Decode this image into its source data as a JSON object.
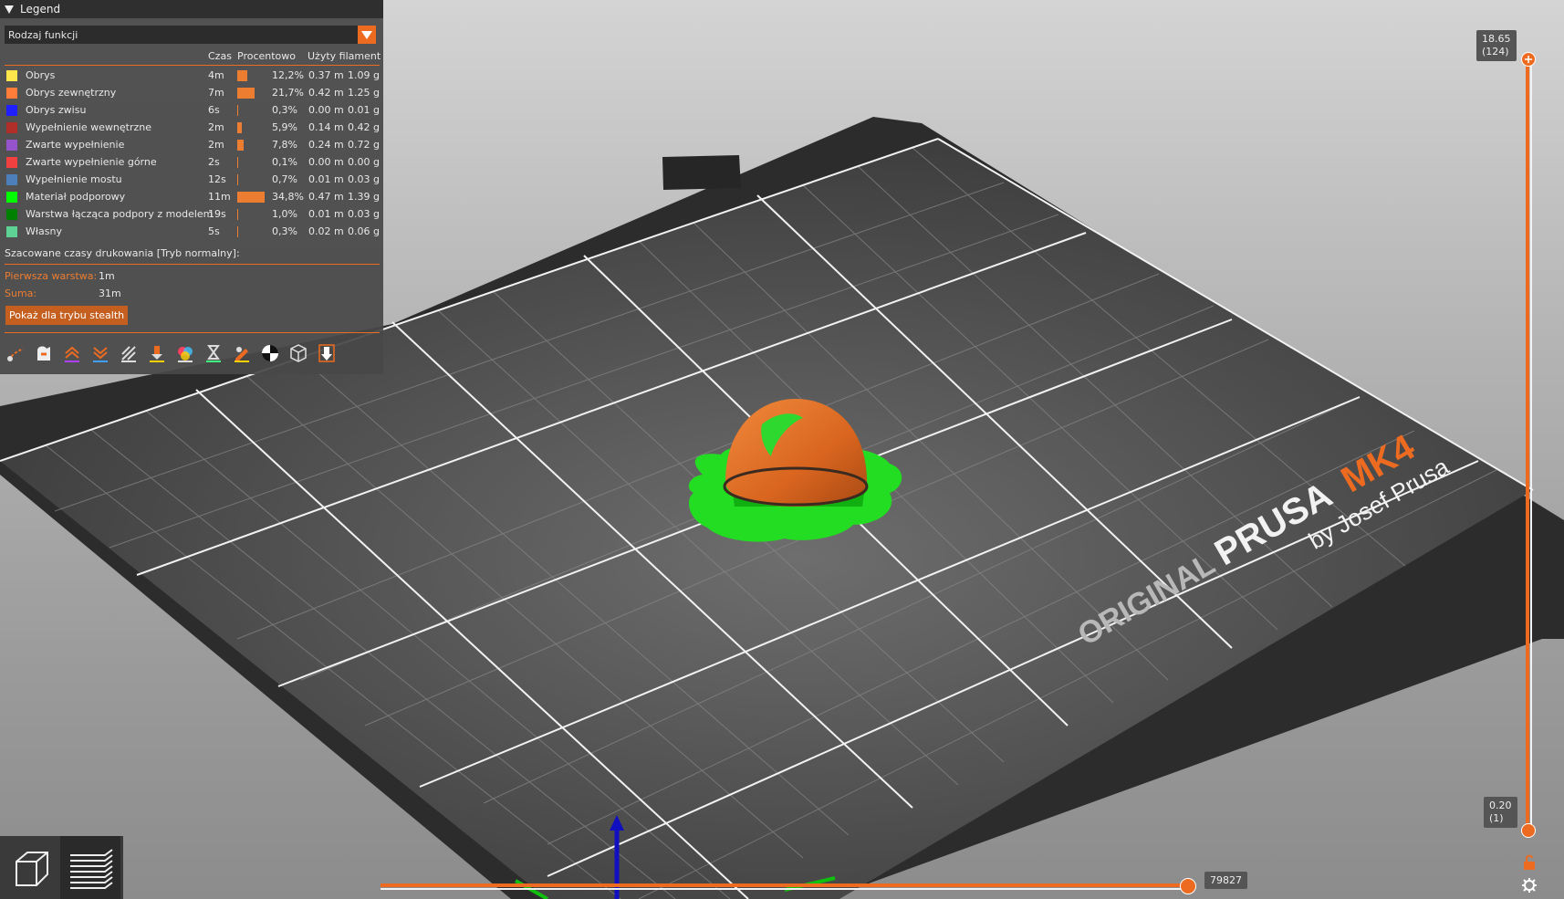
{
  "legend": {
    "title": "Legend",
    "view_type": "Rodzaj funkcji",
    "columns": {
      "time": "Czas",
      "percent": "Procentowo",
      "filament": "Użyty filament"
    },
    "rows": [
      {
        "color": "#FFE64D",
        "name": "Obrys",
        "time": "4m",
        "percent": "12,2%",
        "percent_value": 12.2,
        "length": "0.37 m",
        "weight": "1.09 g"
      },
      {
        "color": "#FF7D38",
        "name": "Obrys zewnętrzny",
        "time": "7m",
        "percent": "21,7%",
        "percent_value": 21.7,
        "length": "0.42 m",
        "weight": "1.25 g"
      },
      {
        "color": "#1F1FFF",
        "name": "Obrys zwisu",
        "time": "6s",
        "percent": "0,3%",
        "percent_value": 0.3,
        "length": "0.00 m",
        "weight": "0.01 g"
      },
      {
        "color": "#B03029",
        "name": "Wypełnienie wewnętrzne",
        "time": "2m",
        "percent": "5,9%",
        "percent_value": 5.9,
        "length": "0.14 m",
        "weight": "0.42 g"
      },
      {
        "color": "#9654CC",
        "name": "Zwarte wypełnienie",
        "time": "2m",
        "percent": "7,8%",
        "percent_value": 7.8,
        "length": "0.24 m",
        "weight": "0.72 g"
      },
      {
        "color": "#F04040",
        "name": "Zwarte wypełnienie górne",
        "time": "2s",
        "percent": "0,1%",
        "percent_value": 0.1,
        "length": "0.00 m",
        "weight": "0.00 g"
      },
      {
        "color": "#4D80BA",
        "name": "Wypełnienie mostu",
        "time": "12s",
        "percent": "0,7%",
        "percent_value": 0.7,
        "length": "0.01 m",
        "weight": "0.03 g"
      },
      {
        "color": "#00FF00",
        "name": "Materiał podporowy",
        "time": "11m",
        "percent": "34,8%",
        "percent_value": 34.8,
        "length": "0.47 m",
        "weight": "1.39 g"
      },
      {
        "color": "#008000",
        "name": "Warstwa łącząca podpory z modelem",
        "time": "19s",
        "percent": "1,0%",
        "percent_value": 1.0,
        "length": "0.01 m",
        "weight": "0.03 g"
      },
      {
        "color": "#5ED194",
        "name": "Własny",
        "time": "5s",
        "percent": "0,3%",
        "percent_value": 0.3,
        "length": "0.02 m",
        "weight": "0.06 g"
      }
    ],
    "estimated_title": "Szacowane czasy drukowania [Tryb normalny]:",
    "first_layer_label": "Pierwsza warstwa:",
    "first_layer_value": "1m",
    "total_label": "Suma:",
    "total_value": "31m",
    "stealth_button": "Pokaż dla trybu stealth"
  },
  "toolbar_icons": [
    "travel-icon",
    "wipe-icon",
    "retractions-icon",
    "deretractions-icon",
    "seams-icon",
    "tool-changes-icon",
    "color-changes-icon",
    "pause-prints-icon",
    "custom-gcodes-icon",
    "center-of-gravity-icon",
    "shells-icon",
    "tool-marker-icon"
  ],
  "vertical_slider": {
    "top_height": "18.65",
    "top_layer": "(124)",
    "bottom_height": "0.20",
    "bottom_layer": "(1)",
    "top_fraction": 1.0,
    "bottom_fraction": 0.0
  },
  "horizontal_slider": {
    "value": "79827",
    "fraction": 1.0
  },
  "bed": {
    "brand_original": "ORIGINAL",
    "brand_prusa": "PRUSA",
    "brand_model": "MK4",
    "brand_by": "by Josef Prusa"
  },
  "colors": {
    "accent": "#ed6b21",
    "support": "#00FF00",
    "model": "#E06A22"
  }
}
